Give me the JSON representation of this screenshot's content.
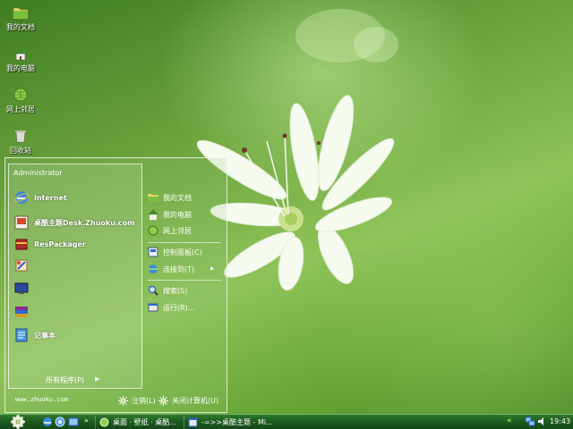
{
  "desktop": {
    "icons": [
      {
        "label": "我的文档",
        "icon": "folder-icon"
      },
      {
        "label": "我的电脑",
        "icon": "computer-icon"
      },
      {
        "label": "网上邻居",
        "icon": "network-icon"
      },
      {
        "label": "回收站",
        "icon": "recycle-bin-icon"
      }
    ]
  },
  "start_menu": {
    "user": "Administrator",
    "left_items": [
      {
        "label": "Internet",
        "icon": "internet-explorer-icon"
      },
      {
        "label": "桌酷主题Desk.Zhuoku.com",
        "icon": "theme-app-icon"
      },
      {
        "label": "ResPackager",
        "icon": "package-icon"
      },
      {
        "label": "",
        "icon": "paint-icon"
      },
      {
        "label": "",
        "icon": "display-icon"
      },
      {
        "label": "",
        "icon": "winrar-icon"
      },
      {
        "label": "记事本",
        "icon": "notepad-icon"
      }
    ],
    "all_programs": "所有程序(P)",
    "right_items": [
      {
        "label": "我的文档",
        "icon": "folder-icon"
      },
      {
        "label": "我的电脑",
        "icon": "computer-icon"
      },
      {
        "label": "网上邻居",
        "icon": "network-icon"
      },
      {
        "label": "控制面板(C)",
        "icon": "control-panel-icon"
      },
      {
        "label": "连接到(T)",
        "icon": "connect-icon"
      },
      {
        "label": "搜索(S)",
        "icon": "search-icon"
      },
      {
        "label": "运行(R)...",
        "icon": "run-icon"
      }
    ],
    "website": "www.zhuoku.com",
    "logoff": "注销(L)",
    "shutdown": "关闭计算机(U)"
  },
  "taskbar": {
    "quick_launch": [
      "internet-explorer-icon",
      "browser-icon",
      "show-desktop-icon"
    ],
    "quick_arrow": "»",
    "tasks": [
      {
        "label": "桌面 · 壁纸 · 桌酷...",
        "icon": "window-icon"
      },
      {
        "label": "-=>>桌酷主题 - Mi...",
        "icon": "editor-icon"
      }
    ],
    "tray_chevron": "«",
    "tray_icons": [
      "network-status-icon",
      "volume-icon"
    ],
    "clock": "19:43"
  },
  "colors": {
    "taskbar": "#1c5a1d",
    "wallpaper": "#6ea53d"
  }
}
